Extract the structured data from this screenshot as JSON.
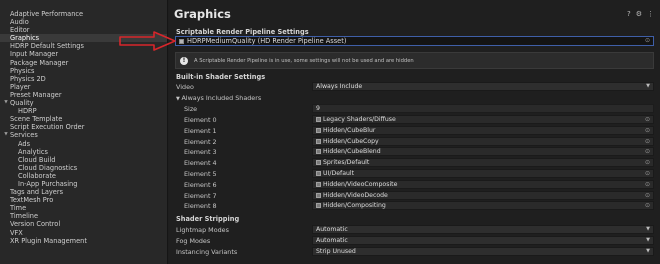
{
  "sidebar": {
    "items": [
      {
        "label": "Adaptive Performance",
        "level": 0
      },
      {
        "label": "Audio",
        "level": 0
      },
      {
        "label": "Editor",
        "level": 0
      },
      {
        "label": "Graphics",
        "level": 0,
        "selected": true
      },
      {
        "label": "HDRP Default Settings",
        "level": 0
      },
      {
        "label": "Input Manager",
        "level": 0
      },
      {
        "label": "Package Manager",
        "level": 0
      },
      {
        "label": "Physics",
        "level": 0
      },
      {
        "label": "Physics 2D",
        "level": 0
      },
      {
        "label": "Player",
        "level": 0
      },
      {
        "label": "Preset Manager",
        "level": 0
      },
      {
        "label": "Quality",
        "level": 0,
        "expanded": true
      },
      {
        "label": "HDRP",
        "level": 1
      },
      {
        "label": "Scene Template",
        "level": 0
      },
      {
        "label": "Script Execution Order",
        "level": 0
      },
      {
        "label": "Services",
        "level": 0,
        "expanded": true
      },
      {
        "label": "Ads",
        "level": 1
      },
      {
        "label": "Analytics",
        "level": 1
      },
      {
        "label": "Cloud Build",
        "level": 1
      },
      {
        "label": "Cloud Diagnostics",
        "level": 1
      },
      {
        "label": "Collaborate",
        "level": 1
      },
      {
        "label": "In-App Purchasing",
        "level": 1
      },
      {
        "label": "Tags and Layers",
        "level": 0
      },
      {
        "label": "TextMesh Pro",
        "level": 0
      },
      {
        "label": "Time",
        "level": 0
      },
      {
        "label": "Timeline",
        "level": 0
      },
      {
        "label": "Version Control",
        "level": 0
      },
      {
        "label": "VFX",
        "level": 0
      },
      {
        "label": "XR Plugin Management",
        "level": 0
      }
    ]
  },
  "header": {
    "title": "Graphics",
    "help_icon": "?",
    "settings_icon": "⚙",
    "menu_icon": "⋮"
  },
  "pipeline": {
    "section_label": "Scriptable Render Pipeline Settings",
    "value": "HDRPMediumQuality (HD Render Pipeline Asset)",
    "info": "A Scriptable Render Pipeline is in use, some settings will not be used and are hidden"
  },
  "builtin": {
    "section_label": "Built-in Shader Settings",
    "video_label": "Video",
    "video_value": "Always Include",
    "always_included_label": "Always Included Shaders",
    "size_label": "Size",
    "size_value": "9",
    "elements": [
      {
        "label": "Element 0",
        "value": "Legacy Shaders/Diffuse"
      },
      {
        "label": "Element 1",
        "value": "Hidden/CubeBlur"
      },
      {
        "label": "Element 2",
        "value": "Hidden/CubeCopy"
      },
      {
        "label": "Element 3",
        "value": "Hidden/CubeBlend"
      },
      {
        "label": "Element 4",
        "value": "Sprites/Default"
      },
      {
        "label": "Element 5",
        "value": "UI/Default"
      },
      {
        "label": "Element 6",
        "value": "Hidden/VideoComposite"
      },
      {
        "label": "Element 7",
        "value": "Hidden/VideoDecode"
      },
      {
        "label": "Element 8",
        "value": "Hidden/Compositing"
      }
    ]
  },
  "stripping": {
    "section_label": "Shader Stripping",
    "rows": [
      {
        "label": "Lightmap Modes",
        "value": "Automatic"
      },
      {
        "label": "Fog Modes",
        "value": "Automatic"
      },
      {
        "label": "Instancing Variants",
        "value": "Strip Unused"
      }
    ]
  },
  "colors": {
    "accent_border": "#3f5fa8",
    "annotation_arrow": "#d8262b",
    "selected_row": "#3a3a3a"
  }
}
